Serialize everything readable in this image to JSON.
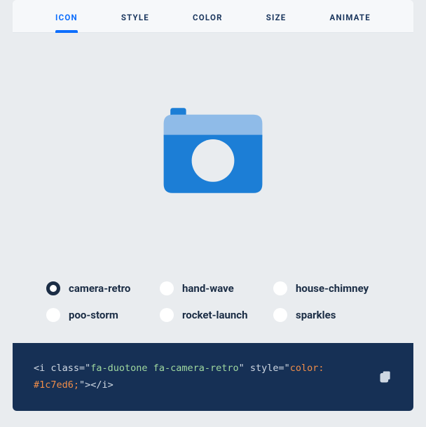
{
  "tabs": [
    {
      "label": "ICON",
      "active": true
    },
    {
      "label": "STYLE",
      "active": false
    },
    {
      "label": "COLOR",
      "active": false
    },
    {
      "label": "SIZE",
      "active": false
    },
    {
      "label": "ANIMATE",
      "active": false
    }
  ],
  "preview_icon": "camera-retro",
  "icon_colors": {
    "primary": "#1c7ed6",
    "secondary": "#8fbbe8"
  },
  "options": [
    {
      "label": "camera-retro",
      "selected": true
    },
    {
      "label": "hand-wave",
      "selected": false
    },
    {
      "label": "house-chimney",
      "selected": false
    },
    {
      "label": "poo-storm",
      "selected": false
    },
    {
      "label": "rocket-launch",
      "selected": false
    },
    {
      "label": "sparkles",
      "selected": false
    }
  ],
  "code": {
    "open": "<i class=\"",
    "class_value": "fa-duotone fa-camera-retro",
    "mid": "\" style=\"",
    "style_value": "color: #1c7ed6;",
    "close": "\"></i>"
  }
}
